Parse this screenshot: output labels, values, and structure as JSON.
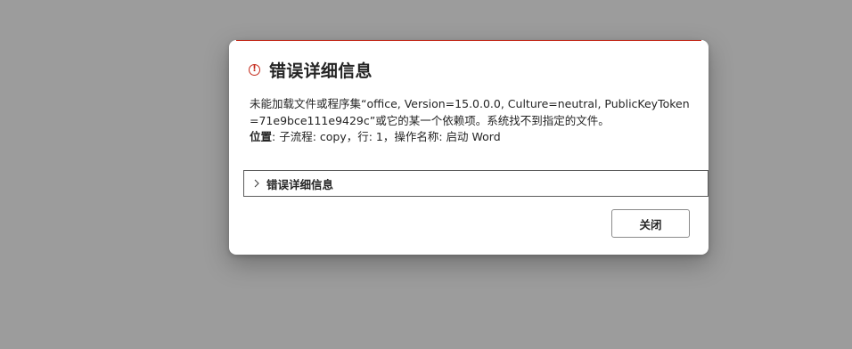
{
  "dialog": {
    "title": "错误详细信息",
    "icon": "error-circle-icon",
    "accent_color": "#c42b1c",
    "message": "未能加载文件或程序集“office, Version=15.0.0.0, Culture=neutral, PublicKeyToken=71e9bce111e9429c”或它的某一个依赖项。系统找不到指定的文件。",
    "location_label": "位置",
    "location_value": ": 子流程: copy，行: 1，操作名称: 启动 Word",
    "details_toggle_label": "错误详细信息",
    "close_button_label": "关闭"
  }
}
